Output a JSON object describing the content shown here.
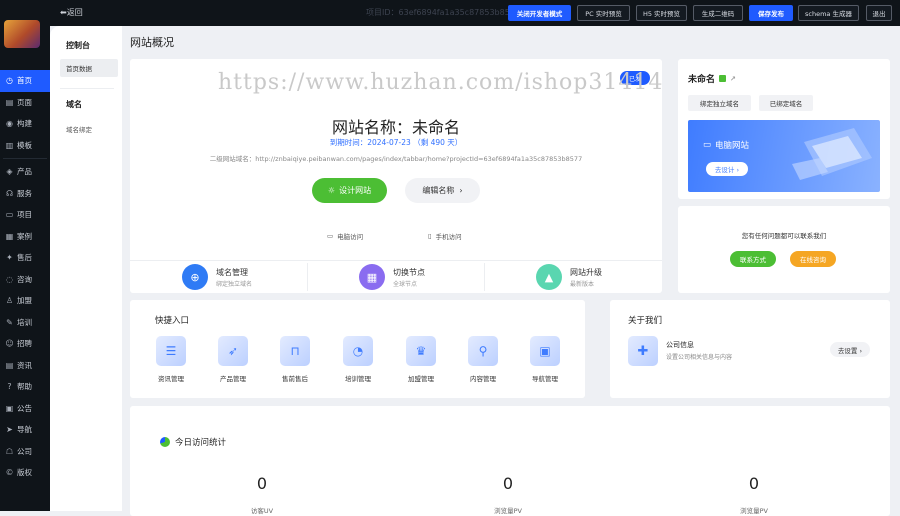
{
  "topbar": {
    "back_label": "⬅返回",
    "project_id_text": "项目ID：63ef6894fa1a35c87853b8577",
    "buttons": [
      {
        "label": "关闭开发者模式",
        "primary": true
      },
      {
        "label": "PC 实时预览",
        "primary": false
      },
      {
        "label": "H5 实时预览",
        "primary": false
      },
      {
        "label": "生成二维码",
        "primary": false
      },
      {
        "label": "保存发布",
        "primary": true
      },
      {
        "label": "schema 生成器",
        "primary": false
      },
      {
        "label": "退出",
        "primary": false
      }
    ]
  },
  "sidebar": {
    "items": [
      {
        "label": "首页",
        "icon": "clock-icon"
      },
      {
        "label": "页面",
        "icon": "page-icon"
      },
      {
        "label": "构建",
        "icon": "eye-icon"
      },
      {
        "label": "模板",
        "icon": "template-icon"
      },
      {
        "label": "产品",
        "icon": "product-icon"
      },
      {
        "label": "服务",
        "icon": "headset-icon"
      },
      {
        "label": "项目",
        "icon": "folder-icon"
      },
      {
        "label": "案例",
        "icon": "case-icon"
      },
      {
        "label": "售后",
        "icon": "aftersale-icon"
      },
      {
        "label": "咨询",
        "icon": "chat-icon"
      },
      {
        "label": "加盟",
        "icon": "user-icon"
      },
      {
        "label": "培训",
        "icon": "training-icon"
      },
      {
        "label": "招聘",
        "icon": "recruit-icon"
      },
      {
        "label": "资讯",
        "icon": "news-icon"
      },
      {
        "label": "帮助",
        "icon": "help-icon"
      },
      {
        "label": "公告",
        "icon": "notice-icon"
      },
      {
        "label": "导航",
        "icon": "nav-icon"
      },
      {
        "label": "公司",
        "icon": "company-icon"
      },
      {
        "label": "版权",
        "icon": "copyright-icon"
      }
    ]
  },
  "subnav": {
    "section1_title": "控制台",
    "section1_active": "首页数据",
    "section2_title": "域名",
    "section2_item": "域名绑定"
  },
  "page_title": "网站概况",
  "site_card": {
    "badge": "已发",
    "watermark": "https://www.huzhan.com/ishop31414",
    "site_name": "网站名称：未命名",
    "expiry": "到期时间：2024-07-23 （剩 490 天）",
    "subdomain": "二级网站域名：http://znbaiqiye.peibanwan.com/pages/index/tabbar/home?projectId=63ef6894fa1a35c87853b8577",
    "design_button": "设计网站",
    "edit_button": "编辑名称",
    "pc_access": "电脑访问",
    "mobile_access": "手机访问",
    "features": [
      {
        "title": "域名管理",
        "sub": "绑定独立域名",
        "color": "#2f7bf5",
        "icon": "www-icon"
      },
      {
        "title": "切换节点",
        "sub": "全球节点",
        "color": "#8a6cf0",
        "icon": "node-icon"
      },
      {
        "title": "网站升级",
        "sub": "最新版本",
        "color": "#5ad6b0",
        "icon": "rocket-icon"
      }
    ]
  },
  "domain_card": {
    "name": "未命名",
    "tab_bind": "绑定独立域名",
    "tab_bound": "已绑定域名",
    "pc_title": "电脑网站",
    "pc_button": "去设计 ›"
  },
  "contact_card": {
    "tip": "您有任何问题都可以联系我们",
    "contact_button": "联系方式",
    "consult_button": "在线咨询",
    "contact_color": "#4cbe34",
    "consult_color": "#f5a623"
  },
  "quick": {
    "title": "快捷入口",
    "items": [
      {
        "label": "资讯管理",
        "icon": "news-icon"
      },
      {
        "label": "产品管理",
        "icon": "rocket-icon"
      },
      {
        "label": "售前售后",
        "icon": "service-icon"
      },
      {
        "label": "培训管理",
        "icon": "training-icon"
      },
      {
        "label": "加盟管理",
        "icon": "crown-icon"
      },
      {
        "label": "内容管理",
        "icon": "search-icon"
      },
      {
        "label": "导航管理",
        "icon": "film-icon"
      }
    ]
  },
  "about": {
    "title": "关于我们",
    "item_name": "公司信息",
    "item_desc": "设置公司相关信息与内容",
    "button": "去设置 ›"
  },
  "stats": {
    "title": "今日访问统计",
    "items": [
      {
        "value": "0",
        "label": "访客UV"
      },
      {
        "value": "0",
        "label": "浏览量PV"
      },
      {
        "value": "0",
        "label": "浏览量PV"
      }
    ]
  }
}
